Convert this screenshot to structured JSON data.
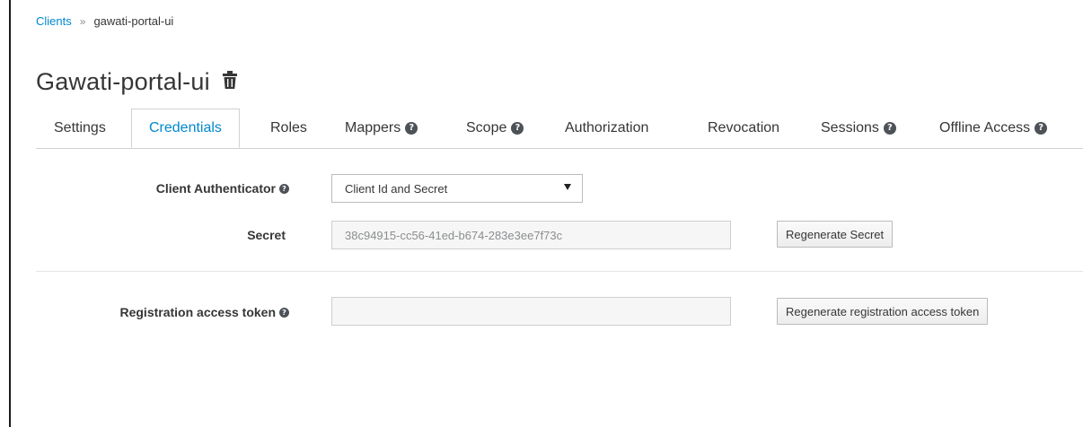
{
  "breadcrumb": {
    "parent": "Clients",
    "separator": "»",
    "current": "gawati-portal-ui"
  },
  "page": {
    "title": "Gawati-portal-ui"
  },
  "tabs": [
    {
      "label": "Settings",
      "help": false
    },
    {
      "label": "Credentials",
      "help": false,
      "active": true
    },
    {
      "label": "Roles",
      "help": false
    },
    {
      "label": "Mappers",
      "help": true
    },
    {
      "label": "Scope",
      "help": true
    },
    {
      "label": "Authorization",
      "help": false
    },
    {
      "label": "Revocation",
      "help": false
    },
    {
      "label": "Sessions",
      "help": true
    },
    {
      "label": "Offline Access",
      "help": true
    }
  ],
  "form": {
    "client_authenticator_label": "Client Authenticator",
    "client_authenticator_value": "Client Id and Secret",
    "secret_label": "Secret",
    "secret_value": "38c94915-cc56-41ed-b674-283e3ee7f73c",
    "regenerate_secret_label": "Regenerate Secret",
    "registration_token_label": "Registration access token",
    "registration_token_value": "",
    "regenerate_token_label": "Regenerate registration access token"
  },
  "colors": {
    "link": "#0088ce",
    "text": "#363636",
    "border": "#d1d1d1"
  },
  "icons": {
    "help": "question-circle-icon",
    "delete": "trash-icon"
  }
}
